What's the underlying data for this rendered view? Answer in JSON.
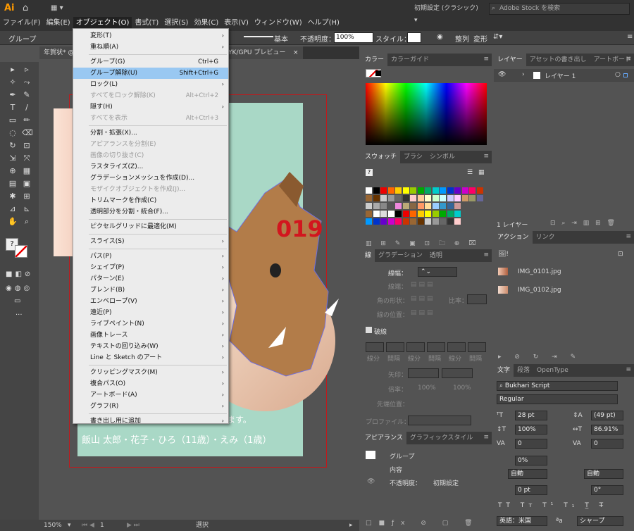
{
  "app": {
    "logo": "Ai",
    "workspace": "初期設定 (クラシック)",
    "stock_placeholder": "Adobe Stock を検索"
  },
  "menubar": [
    "ファイル(F)",
    "編集(E)",
    "オブジェクト(O)",
    "書式(T)",
    "選択(S)",
    "効果(C)",
    "表示(V)",
    "ウィンドウ(W)",
    "ヘルプ(H)"
  ],
  "control": {
    "selection": "グループ",
    "stroke_style": "基本",
    "opacity_label": "不透明度：",
    "opacity": "100%",
    "style_label": "スタイル：",
    "align": "整列",
    "transform": "変形"
  },
  "document": {
    "tab": "年賀状* @",
    "mode": "CMYK/GPU プレビュー",
    "zoom": "150%",
    "page": "1",
    "status": "選択"
  },
  "artwork": {
    "year": "019",
    "message": "ます。",
    "names": "飯山 太郎・花子・ひろ（11歳）・えみ（1歳）"
  },
  "dropdown": [
    {
      "label": "変形(T)",
      "arrow": true
    },
    {
      "label": "重ね順(A)",
      "arrow": true
    },
    {
      "sep": true
    },
    {
      "label": "グループ(G)",
      "shortcut": "Ctrl+G"
    },
    {
      "label": "グループ解除(U)",
      "shortcut": "Shift+Ctrl+G",
      "highlight": true
    },
    {
      "label": "ロック(L)",
      "arrow": true
    },
    {
      "label": "すべてをロック解除(K)",
      "shortcut": "Alt+Ctrl+2",
      "disabled": true
    },
    {
      "label": "隠す(H)",
      "arrow": true
    },
    {
      "label": "すべてを表示",
      "shortcut": "Alt+Ctrl+3",
      "disabled": true
    },
    {
      "sep": true
    },
    {
      "label": "分割・拡張(X)..."
    },
    {
      "label": "アピアランスを分割(E)",
      "disabled": true
    },
    {
      "label": "画像の切り抜き(C)",
      "disabled": true
    },
    {
      "label": "ラスタライズ(Z)..."
    },
    {
      "label": "グラデーションメッシュを作成(D)..."
    },
    {
      "label": "モザイクオブジェクトを作成(J)...",
      "disabled": true
    },
    {
      "label": "トリムマークを作成(C)"
    },
    {
      "label": "透明部分を分割・統合(F)..."
    },
    {
      "sep": true
    },
    {
      "label": "ピクセルグリッドに最適化(M)"
    },
    {
      "sep": true
    },
    {
      "label": "スライス(S)",
      "arrow": true
    },
    {
      "sep": true
    },
    {
      "label": "パス(P)",
      "arrow": true
    },
    {
      "label": "シェイプ(P)",
      "arrow": true
    },
    {
      "label": "パターン(E)",
      "arrow": true
    },
    {
      "label": "ブレンド(B)",
      "arrow": true
    },
    {
      "label": "エンベロープ(V)",
      "arrow": true
    },
    {
      "label": "遠近(P)",
      "arrow": true
    },
    {
      "label": "ライブペイント(N)",
      "arrow": true
    },
    {
      "label": "画像トレース",
      "arrow": true
    },
    {
      "label": "テキストの回り込み(W)",
      "arrow": true
    },
    {
      "label": "Line と Sketch のアート",
      "arrow": true
    },
    {
      "sep": true
    },
    {
      "label": "クリッピングマスク(M)",
      "arrow": true
    },
    {
      "label": "複合パス(O)",
      "arrow": true
    },
    {
      "label": "アートボード(A)",
      "arrow": true
    },
    {
      "label": "グラフ(R)",
      "arrow": true
    },
    {
      "sep": true
    },
    {
      "label": "書き出し用に追加",
      "arrow": true
    }
  ],
  "color_panel": {
    "tabs": [
      "カラー",
      "カラーガイド"
    ]
  },
  "swatch_panel": {
    "tabs": [
      "スウォッチ",
      "ブラシ",
      "シンボル"
    ]
  },
  "stroke_panel": {
    "tabs": [
      "線",
      "グラデーション",
      "透明"
    ],
    "weight": "線幅：",
    "cap": "線端：",
    "corner": "角の形状：",
    "limit": "比率：",
    "align": "線の位置：",
    "dashed": "破線",
    "dash_labels": [
      "線分",
      "間隔",
      "線分",
      "間隔",
      "線分",
      "間隔"
    ],
    "arrow": "矢印：",
    "scale": "倍率：",
    "scale_v1": "100%",
    "scale_v2": "100%",
    "pos": "先端位置：",
    "profile": "プロファイル："
  },
  "appearance_panel": {
    "tabs": [
      "アピアランス",
      "グラフィックスタイル"
    ],
    "group": "グループ",
    "content": "内容",
    "opacity_label": "不透明度：",
    "opacity_value": "初期設定"
  },
  "layers_panel": {
    "tabs": [
      "レイヤー",
      "アセットの書き出し",
      "アートボード"
    ],
    "layer": "レイヤー 1",
    "count": "1 レイヤー"
  },
  "links_panel": {
    "tabs": [
      "アクション",
      "リンク"
    ],
    "files": [
      "IMG_0101.jpg",
      "IMG_0102.jpg"
    ]
  },
  "char_panel": {
    "tabs": [
      "文字",
      "段落",
      "OpenType"
    ],
    "font": "Bukhari Script",
    "style": "Regular",
    "size": "28 pt",
    "leading": "(49 pt)",
    "hscale": "100%",
    "vscale": "86.91%",
    "kern": "0",
    "track": "0",
    "shift": "0%",
    "auto1": "自動",
    "auto2": "自動",
    "baseline": "0 pt",
    "rotate": "0°",
    "lang": "英語：米国",
    "aa": "シャープ"
  }
}
